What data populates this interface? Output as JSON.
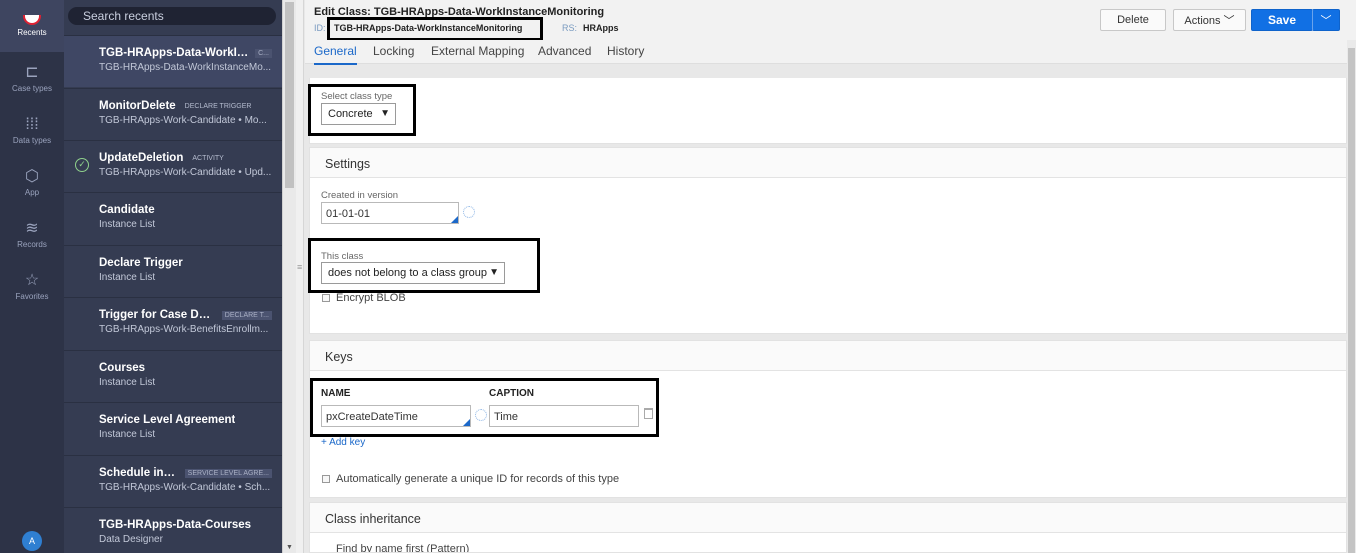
{
  "rail": {
    "items": [
      {
        "label": "Recents",
        "icon": "recents-icon"
      },
      {
        "label": "Case types",
        "icon": "case-types-icon"
      },
      {
        "label": "Data types",
        "icon": "data-types-icon"
      },
      {
        "label": "App",
        "icon": "app-cube-icon"
      },
      {
        "label": "Records",
        "icon": "records-icon"
      },
      {
        "label": "Favorites",
        "icon": "star-icon"
      }
    ],
    "avatar": "A"
  },
  "recents": {
    "search_placeholder": "Search recents",
    "items": [
      {
        "title": "TGB-HRApps-Data-WorkIns...",
        "tag": "C...",
        "sub": "TGB-HRApps-Data-WorkInstanceMo..."
      },
      {
        "title": "MonitorDelete",
        "tag": "DECLARE TRIGGER",
        "sub": "TGB-HRApps-Work-Candidate • Mo..."
      },
      {
        "title": "UpdateDeletion",
        "tag": "ACTIVITY",
        "sub": "TGB-HRApps-Work-Candidate • Upd..."
      },
      {
        "title": "Candidate",
        "tag": "",
        "sub": "Instance List"
      },
      {
        "title": "Declare Trigger",
        "tag": "",
        "sub": "Instance List"
      },
      {
        "title": "Trigger for Case Dep...",
        "tag": "DECLARE T...",
        "sub": "TGB-HRApps-Work-BenefitsEnrollm..."
      },
      {
        "title": "Courses",
        "tag": "",
        "sub": "Instance List"
      },
      {
        "title": "Service Level Agreement",
        "tag": "",
        "sub": "Instance List"
      },
      {
        "title": "Schedule inte...",
        "tag": "SERVICE LEVEL AGRE...",
        "sub": "TGB-HRApps-Work-Candidate • Sch..."
      },
      {
        "title": "TGB-HRApps-Data-Courses",
        "tag": "",
        "sub": "Data Designer"
      }
    ]
  },
  "header": {
    "title": "Edit  Class: TGB-HRApps-Data-WorkInstanceMonitoring",
    "id_label": "ID:",
    "id_value": "TGB-HRApps-Data-WorkInstanceMonitoring",
    "rs_label": "RS:",
    "rs_value": "HRApps",
    "delete_label": "Delete",
    "actions_label": "Actions ﹀",
    "save_label": "Save",
    "save_menu_icon": "﹀"
  },
  "tabs": [
    "General",
    "Locking",
    "External Mapping",
    "Advanced",
    "History"
  ],
  "class_type": {
    "label": "Select class type",
    "value": "Concrete"
  },
  "settings": {
    "heading": "Settings",
    "created_label": "Created in version",
    "created_value": "01-01-01",
    "this_class_label": "This class",
    "this_class_value": "does not belong to a class group",
    "encrypt_label": "Encrypt BLOB"
  },
  "keys": {
    "heading": "Keys",
    "col_name": "NAME",
    "col_caption": "CAPTION",
    "name_value": "pxCreateDateTime",
    "caption_value": "Time",
    "add_key": "+ Add key",
    "auto_id_label": "Automatically generate a unique ID for records of this type"
  },
  "inheritance": {
    "heading": "Class inheritance",
    "partial_row": "Find by name first (Pattern)"
  }
}
